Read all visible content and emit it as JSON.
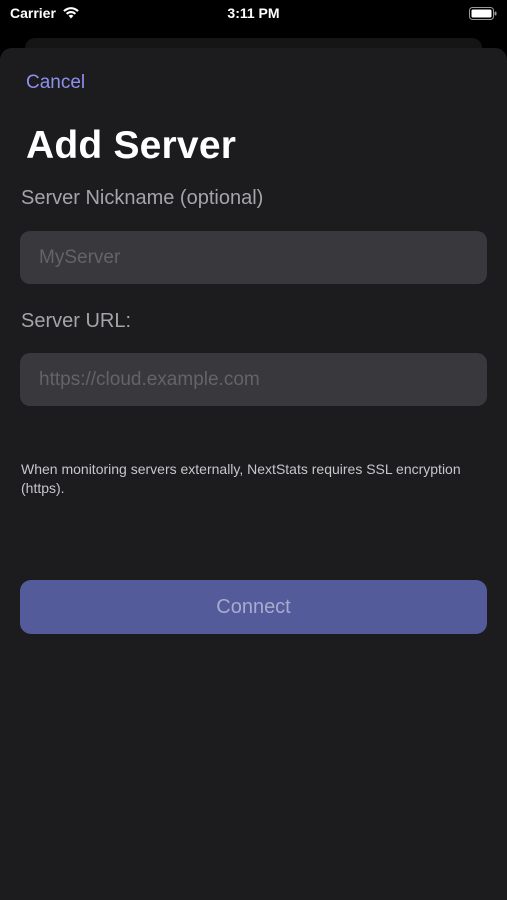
{
  "status_bar": {
    "carrier": "Carrier",
    "time": "3:11 PM",
    "wifi_icon": "wifi-icon",
    "battery_icon": "battery-icon"
  },
  "sheet": {
    "cancel_label": "Cancel",
    "title": "Add Server",
    "nickname": {
      "label": "Server Nickname (optional)",
      "value": "",
      "placeholder": "MyServer"
    },
    "url": {
      "label": "Server URL:",
      "value": "",
      "placeholder": "https://cloud.example.com"
    },
    "note": "When monitoring servers externally, NextStats requires SSL encryption (https).",
    "connect_label": "Connect"
  },
  "colors": {
    "accent": "#8e8ff0",
    "button": "#545b9a",
    "background": "#1c1c1e",
    "field": "#39393d"
  }
}
